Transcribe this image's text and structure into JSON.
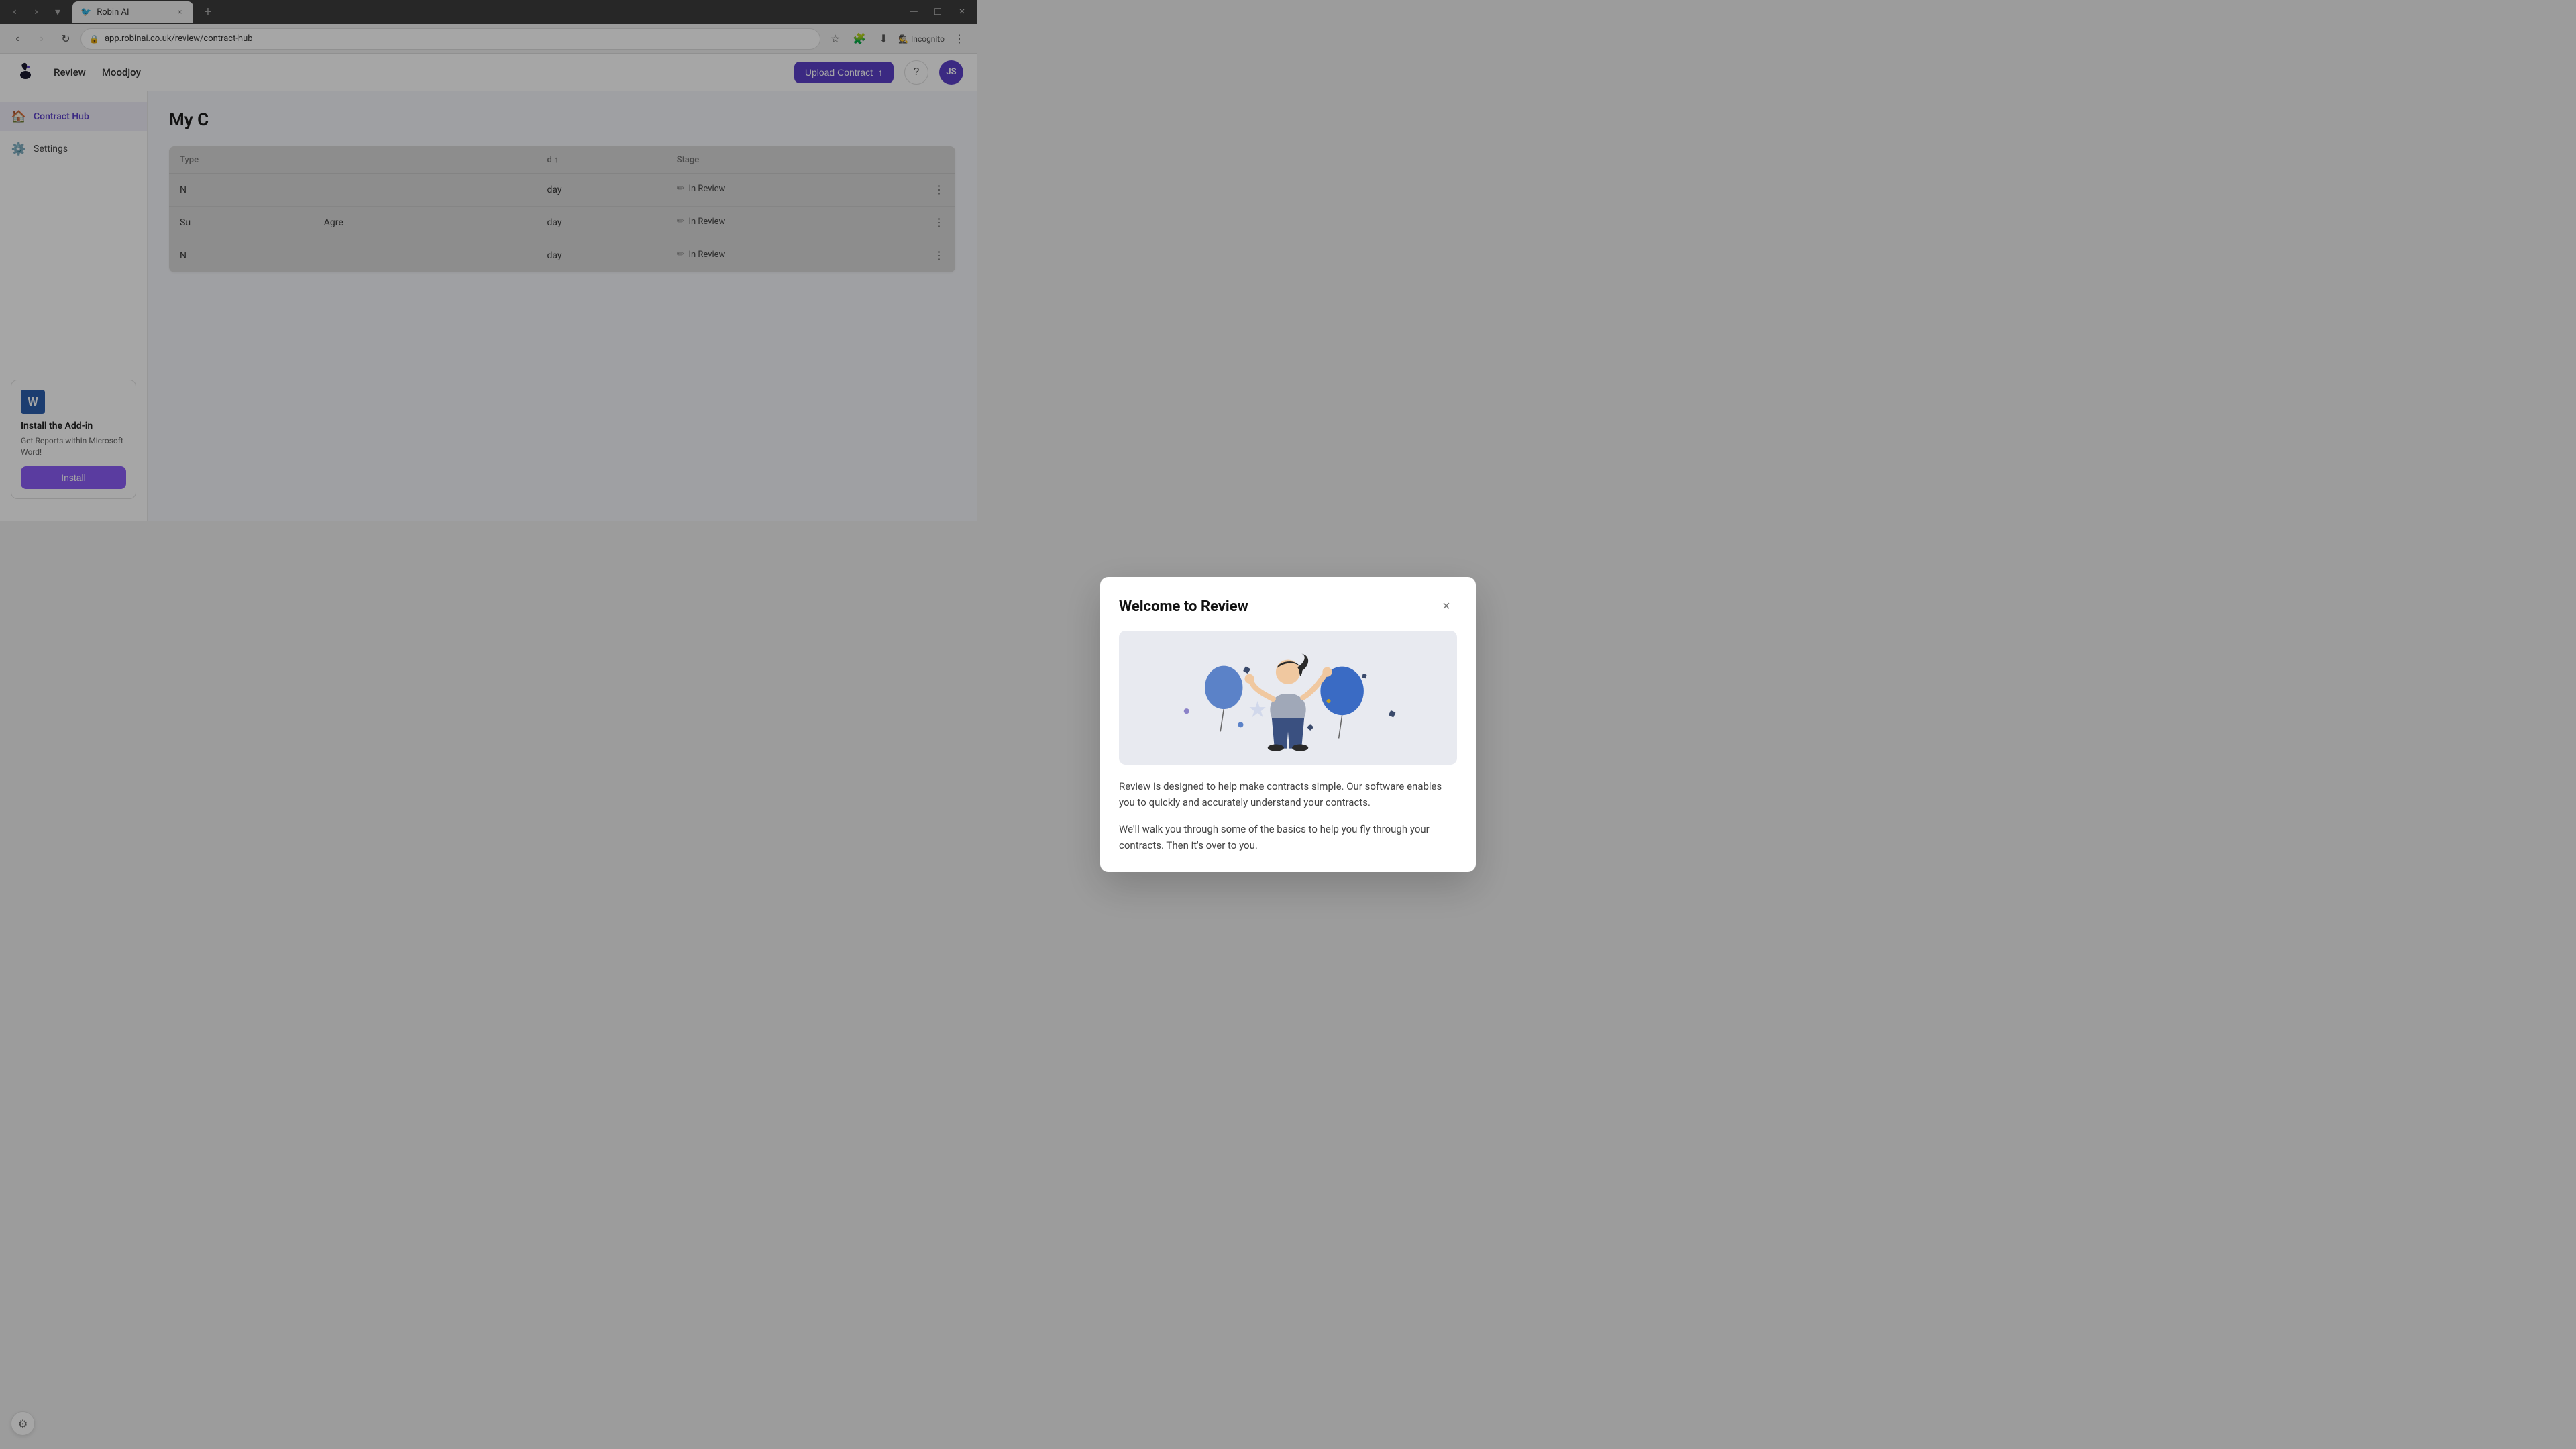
{
  "browser": {
    "tab_label": "Robin AI",
    "tab_favicon": "🐦",
    "url": "app.robinai.co.uk/review/contract-hub",
    "incognito_label": "Incognito"
  },
  "app_header": {
    "nav_review": "Review",
    "company_name": "Moodjoy",
    "upload_btn_label": "Upload Contract",
    "upload_icon": "↑",
    "help_icon": "?",
    "user_initials": "JS"
  },
  "sidebar": {
    "items": [
      {
        "id": "contract-hub",
        "label": "Contract Hub",
        "icon": "🏠",
        "active": true
      },
      {
        "id": "settings",
        "label": "Settings",
        "icon": "⚙️",
        "active": false
      }
    ],
    "addin_card": {
      "title": "Install the Add-in",
      "description": "Get Reports within Microsoft Word!",
      "btn_label": "Install"
    }
  },
  "main": {
    "page_title": "My C",
    "table": {
      "columns": [
        "Type",
        "",
        "",
        "d ↑",
        "Stage"
      ],
      "rows": [
        {
          "type": "N",
          "stage": "In Review"
        },
        {
          "type": "Su",
          "name": "Agre",
          "stage": "In Review"
        },
        {
          "type": "N",
          "stage": "In Review"
        }
      ]
    }
  },
  "modal": {
    "title": "Welcome to Review",
    "close_icon": "×",
    "text_primary": "Review is designed to help make contracts simple. Our software enables you to quickly and accurately understand your contracts.",
    "text_secondary": "We'll walk you through some of the basics to help you fly through your contracts. Then it's over to you.",
    "illustration_alt": "Celebration illustration with person and balloons"
  },
  "bottom_widget": {
    "icon": "⚙",
    "tooltip": "Settings widget"
  },
  "colors": {
    "brand_purple": "#5b3fc8",
    "brand_purple_light": "#8b5cf6",
    "sidebar_active_bg": "#f0eef9",
    "table_stage_color": "#555555"
  }
}
